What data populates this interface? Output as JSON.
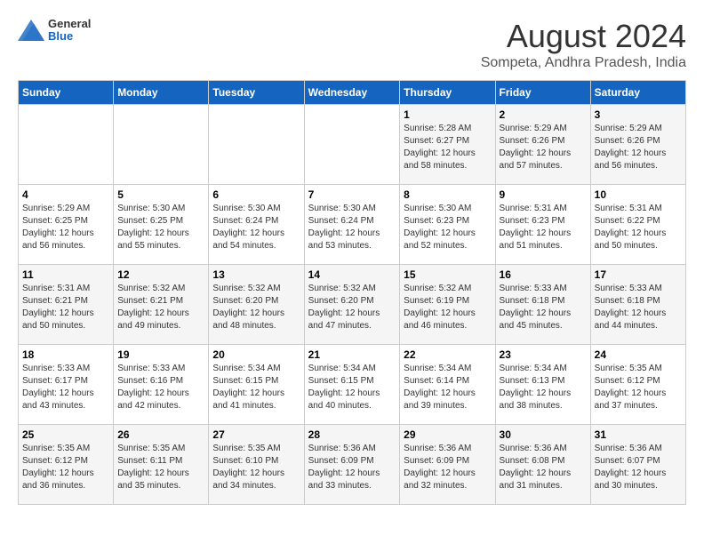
{
  "header": {
    "logo_general": "General",
    "logo_blue": "Blue",
    "title": "August 2024",
    "subtitle": "Sompeta, Andhra Pradesh, India"
  },
  "days_of_week": [
    "Sunday",
    "Monday",
    "Tuesday",
    "Wednesday",
    "Thursday",
    "Friday",
    "Saturday"
  ],
  "weeks": [
    [
      {
        "day": "",
        "info": ""
      },
      {
        "day": "",
        "info": ""
      },
      {
        "day": "",
        "info": ""
      },
      {
        "day": "",
        "info": ""
      },
      {
        "day": "1",
        "info": "Sunrise: 5:28 AM\nSunset: 6:27 PM\nDaylight: 12 hours\nand 58 minutes."
      },
      {
        "day": "2",
        "info": "Sunrise: 5:29 AM\nSunset: 6:26 PM\nDaylight: 12 hours\nand 57 minutes."
      },
      {
        "day": "3",
        "info": "Sunrise: 5:29 AM\nSunset: 6:26 PM\nDaylight: 12 hours\nand 56 minutes."
      }
    ],
    [
      {
        "day": "4",
        "info": "Sunrise: 5:29 AM\nSunset: 6:25 PM\nDaylight: 12 hours\nand 56 minutes."
      },
      {
        "day": "5",
        "info": "Sunrise: 5:30 AM\nSunset: 6:25 PM\nDaylight: 12 hours\nand 55 minutes."
      },
      {
        "day": "6",
        "info": "Sunrise: 5:30 AM\nSunset: 6:24 PM\nDaylight: 12 hours\nand 54 minutes."
      },
      {
        "day": "7",
        "info": "Sunrise: 5:30 AM\nSunset: 6:24 PM\nDaylight: 12 hours\nand 53 minutes."
      },
      {
        "day": "8",
        "info": "Sunrise: 5:30 AM\nSunset: 6:23 PM\nDaylight: 12 hours\nand 52 minutes."
      },
      {
        "day": "9",
        "info": "Sunrise: 5:31 AM\nSunset: 6:23 PM\nDaylight: 12 hours\nand 51 minutes."
      },
      {
        "day": "10",
        "info": "Sunrise: 5:31 AM\nSunset: 6:22 PM\nDaylight: 12 hours\nand 50 minutes."
      }
    ],
    [
      {
        "day": "11",
        "info": "Sunrise: 5:31 AM\nSunset: 6:21 PM\nDaylight: 12 hours\nand 50 minutes."
      },
      {
        "day": "12",
        "info": "Sunrise: 5:32 AM\nSunset: 6:21 PM\nDaylight: 12 hours\nand 49 minutes."
      },
      {
        "day": "13",
        "info": "Sunrise: 5:32 AM\nSunset: 6:20 PM\nDaylight: 12 hours\nand 48 minutes."
      },
      {
        "day": "14",
        "info": "Sunrise: 5:32 AM\nSunset: 6:20 PM\nDaylight: 12 hours\nand 47 minutes."
      },
      {
        "day": "15",
        "info": "Sunrise: 5:32 AM\nSunset: 6:19 PM\nDaylight: 12 hours\nand 46 minutes."
      },
      {
        "day": "16",
        "info": "Sunrise: 5:33 AM\nSunset: 6:18 PM\nDaylight: 12 hours\nand 45 minutes."
      },
      {
        "day": "17",
        "info": "Sunrise: 5:33 AM\nSunset: 6:18 PM\nDaylight: 12 hours\nand 44 minutes."
      }
    ],
    [
      {
        "day": "18",
        "info": "Sunrise: 5:33 AM\nSunset: 6:17 PM\nDaylight: 12 hours\nand 43 minutes."
      },
      {
        "day": "19",
        "info": "Sunrise: 5:33 AM\nSunset: 6:16 PM\nDaylight: 12 hours\nand 42 minutes."
      },
      {
        "day": "20",
        "info": "Sunrise: 5:34 AM\nSunset: 6:15 PM\nDaylight: 12 hours\nand 41 minutes."
      },
      {
        "day": "21",
        "info": "Sunrise: 5:34 AM\nSunset: 6:15 PM\nDaylight: 12 hours\nand 40 minutes."
      },
      {
        "day": "22",
        "info": "Sunrise: 5:34 AM\nSunset: 6:14 PM\nDaylight: 12 hours\nand 39 minutes."
      },
      {
        "day": "23",
        "info": "Sunrise: 5:34 AM\nSunset: 6:13 PM\nDaylight: 12 hours\nand 38 minutes."
      },
      {
        "day": "24",
        "info": "Sunrise: 5:35 AM\nSunset: 6:12 PM\nDaylight: 12 hours\nand 37 minutes."
      }
    ],
    [
      {
        "day": "25",
        "info": "Sunrise: 5:35 AM\nSunset: 6:12 PM\nDaylight: 12 hours\nand 36 minutes."
      },
      {
        "day": "26",
        "info": "Sunrise: 5:35 AM\nSunset: 6:11 PM\nDaylight: 12 hours\nand 35 minutes."
      },
      {
        "day": "27",
        "info": "Sunrise: 5:35 AM\nSunset: 6:10 PM\nDaylight: 12 hours\nand 34 minutes."
      },
      {
        "day": "28",
        "info": "Sunrise: 5:36 AM\nSunset: 6:09 PM\nDaylight: 12 hours\nand 33 minutes."
      },
      {
        "day": "29",
        "info": "Sunrise: 5:36 AM\nSunset: 6:09 PM\nDaylight: 12 hours\nand 32 minutes."
      },
      {
        "day": "30",
        "info": "Sunrise: 5:36 AM\nSunset: 6:08 PM\nDaylight: 12 hours\nand 31 minutes."
      },
      {
        "day": "31",
        "info": "Sunrise: 5:36 AM\nSunset: 6:07 PM\nDaylight: 12 hours\nand 30 minutes."
      }
    ]
  ]
}
